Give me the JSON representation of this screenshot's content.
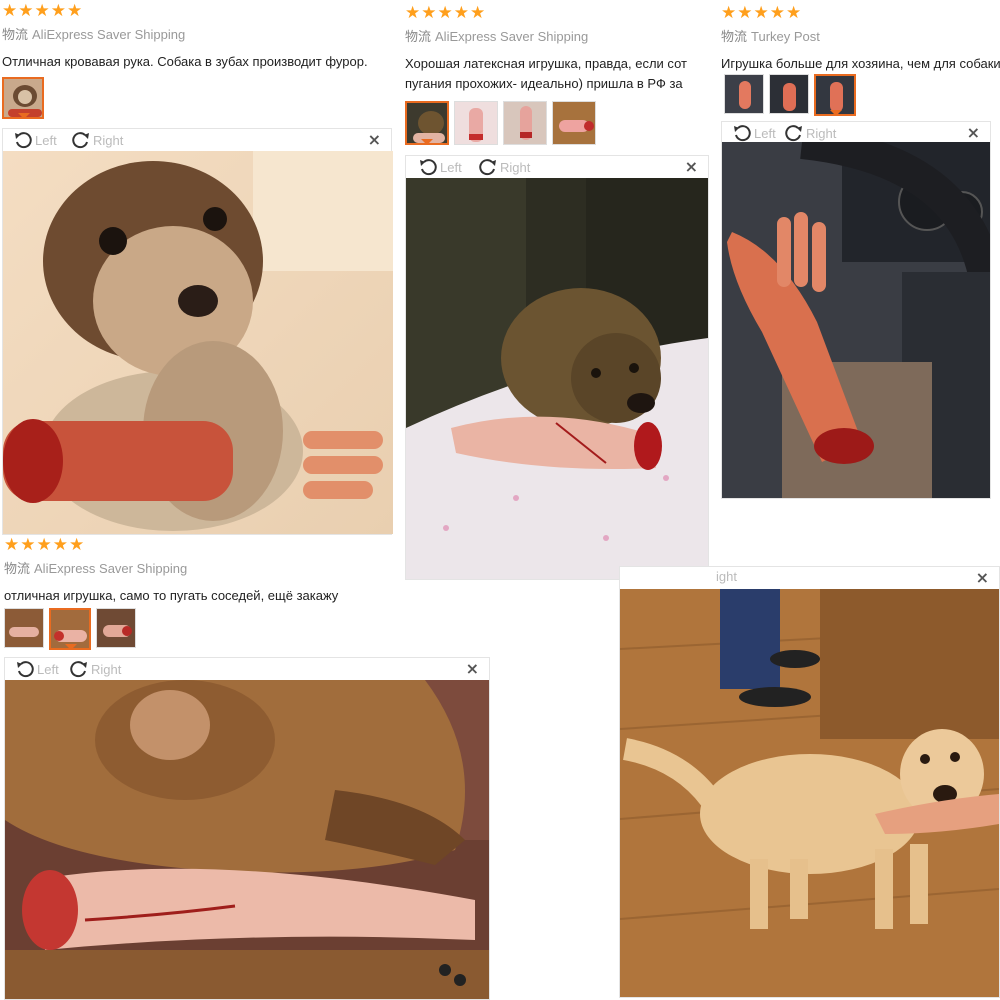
{
  "reviews": [
    {
      "stars": 5,
      "shipping_label": "物流",
      "shipping_method": "AliExpress Saver Shipping",
      "comment": "Отличная кровавая рука. Собака в зубах производит фурор.",
      "viewer": {
        "left_label": "Left",
        "right_label": "Right",
        "close": "×"
      }
    },
    {
      "stars": 5,
      "shipping_label": "物流",
      "shipping_method": "AliExpress Saver Shipping",
      "comment": "Хорошая латексная игрушка, правда, если сот пугания прохожих- идеально) пришла в РФ за",
      "viewer": {
        "left_label": "Left",
        "right_label": "Right",
        "close": "×"
      }
    },
    {
      "stars": 5,
      "shipping_label": "物流",
      "shipping_method": "Turkey Post",
      "comment": "Игрушка больше для хозяина, чем для собаки.",
      "viewer": {
        "left_label": "Left",
        "right_label": "Right",
        "close": "×"
      }
    },
    {
      "stars": 5,
      "shipping_label": "物流",
      "shipping_method": "AliExpress Saver Shipping",
      "comment": "отличная игрушка, само то пугать соседей, ещё закажу",
      "viewer": {
        "left_label": "Left",
        "right_label": "Right",
        "close": "×"
      }
    },
    {
      "viewer": {
        "right_label": "ight",
        "close": "×"
      }
    }
  ],
  "colors": {
    "star": "#ff9f1c",
    "active_thumb": "#e96b20"
  },
  "icons": [
    "star-icon",
    "rotate-left-icon",
    "rotate-right-icon",
    "close-icon"
  ]
}
